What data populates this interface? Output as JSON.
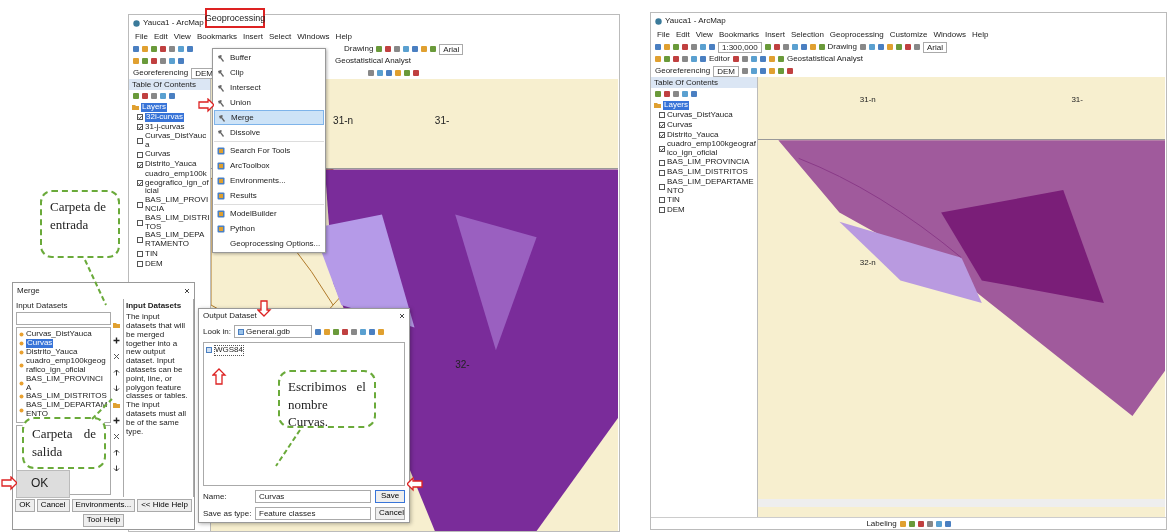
{
  "left_figure": {
    "arcmap": {
      "title": "Yauca1 - ArcMap",
      "menu": [
        "File",
        "Edit",
        "View",
        "Bookmarks",
        "Insert",
        "Select",
        "Windows",
        "Help"
      ],
      "toolbars": [
        {
          "items": [
            {
              "kind": "icons"
            },
            {
              "kind": "label",
              "text": "Drawing"
            },
            {
              "kind": "icons"
            },
            {
              "kind": "combo",
              "value": "Arial"
            }
          ]
        },
        {
          "items": [
            {
              "kind": "icons"
            },
            {
              "kind": "label",
              "text": "Geostatistical Analyst"
            }
          ]
        },
        {
          "items": [
            {
              "kind": "label",
              "text": "Georeferencing"
            },
            {
              "kind": "combo",
              "value": "DEM"
            },
            {
              "kind": "icons"
            }
          ]
        }
      ],
      "toc": {
        "title": "Table Of Contents",
        "root": "Layers",
        "layers": [
          {
            "name": "32i-curvas",
            "checked": true,
            "selected": true
          },
          {
            "name": "31-j-curvas",
            "checked": true,
            "selected": false
          },
          {
            "name": "Curvas_DistYauca",
            "checked": false,
            "selected": false
          },
          {
            "name": "Curvas",
            "checked": false,
            "selected": false
          },
          {
            "name": "Distrito_Yauca",
            "checked": true,
            "selected": false
          },
          {
            "name": "cuadro_emp100kgeografico_ign_oficial",
            "checked": true,
            "selected": false
          },
          {
            "name": "BAS_LIM_PROVINCIA",
            "checked": false,
            "selected": false
          },
          {
            "name": "BAS_LIM_DISTRITOS",
            "checked": false,
            "selected": false
          },
          {
            "name": "BAS_LIM_DEPARTAMENTO",
            "checked": false,
            "selected": false
          },
          {
            "name": "TIN",
            "checked": false,
            "selected": false
          },
          {
            "name": "DEM",
            "checked": false,
            "selected": false
          }
        ]
      },
      "map_labels": [
        "31-n",
        "31-",
        "32-"
      ]
    },
    "geoprocessing_label": "Geoprocessing",
    "geoprocessing_menu": {
      "groups": [
        {
          "items": [
            {
              "label": "Buffer",
              "kind": "tool",
              "selected": false
            },
            {
              "label": "Clip",
              "kind": "tool",
              "selected": false
            },
            {
              "label": "Intersect",
              "kind": "tool",
              "selected": false
            },
            {
              "label": "Union",
              "kind": "tool",
              "selected": false
            },
            {
              "label": "Merge",
              "kind": "tool",
              "selected": true
            },
            {
              "label": "Dissolve",
              "kind": "tool",
              "selected": false
            }
          ]
        },
        {
          "items": [
            {
              "label": "Search For Tools",
              "kind": "app",
              "selected": false
            },
            {
              "label": "ArcToolbox",
              "kind": "app",
              "selected": false
            },
            {
              "label": "Environments...",
              "kind": "app",
              "selected": false
            },
            {
              "label": "Results",
              "kind": "app",
              "selected": false
            }
          ]
        },
        {
          "items": [
            {
              "label": "ModelBuilder",
              "kind": "app",
              "selected": false
            },
            {
              "label": "Python",
              "kind": "app",
              "selected": false
            },
            {
              "label": "Geoprocessing Options...",
              "kind": "text",
              "selected": false
            }
          ]
        }
      ]
    },
    "merge_dialog": {
      "title": "Merge",
      "section": "Input Datasets",
      "datasets": [
        {
          "name": "Curvas_DistYauca",
          "selected": false
        },
        {
          "name": "Curvas",
          "selected": true
        },
        {
          "name": "Distrito_Yauca",
          "selected": false
        },
        {
          "name": "cuadro_emp100kgeografico_ign_oficial",
          "selected": false
        },
        {
          "name": "BAS_LIM_PROVINCIA",
          "selected": false
        },
        {
          "name": "BAS_LIM_DISTRITOS",
          "selected": false
        },
        {
          "name": "BAS_LIM_DEPARTAMENTO",
          "selected": false
        }
      ],
      "help_title": "Input Datasets",
      "help_text": "The input datasets that will be merged together into a new output dataset. Input datasets can be point, line, or polygon feature classes or tables. The input datasets must all be of the same type.",
      "buttons": [
        "OK",
        "Cancel",
        "Environments...",
        "<< Hide Help",
        "Tool Help"
      ]
    },
    "output_dialog": {
      "title": "Output Dataset",
      "look_in_label": "Look in:",
      "look_in": "General.gdb",
      "items": [
        "WGS84"
      ],
      "name_label": "Name:",
      "name": "Curvas",
      "type_label": "Save as type:",
      "type": "Feature classes",
      "buttons": [
        "Save",
        "Cancel"
      ]
    },
    "callouts": [
      "Carpeta de entrada",
      "Carpeta de salida",
      "Escribimos el nombre Curvas."
    ],
    "ok_label": "OK"
  },
  "right_figure": {
    "arcmap": {
      "title": "Yauca1 - ArcMap",
      "menu": [
        "File",
        "Edit",
        "View",
        "Bookmarks",
        "Insert",
        "Selection",
        "Geoprocessing",
        "Customize",
        "Windows",
        "Help"
      ],
      "toolbars": [
        {
          "items": [
            {
              "kind": "icons"
            },
            {
              "kind": "combo",
              "value": "1:300,000"
            },
            {
              "kind": "icons"
            },
            {
              "kind": "label",
              "text": "Drawing"
            },
            {
              "kind": "icons"
            },
            {
              "kind": "combo",
              "value": "Arial"
            }
          ]
        },
        {
          "items": [
            {
              "kind": "icons"
            },
            {
              "kind": "label",
              "text": "Editor"
            },
            {
              "kind": "icons"
            },
            {
              "kind": "label",
              "text": "Geostatistical Analyst"
            }
          ]
        },
        {
          "items": [
            {
              "kind": "label",
              "text": "Georeferencing"
            },
            {
              "kind": "combo",
              "value": "DEM"
            },
            {
              "kind": "icons"
            }
          ]
        }
      ],
      "toc": {
        "title": "Table Of Contents",
        "root": "Layers",
        "layers": [
          {
            "name": "Curvas_DistYauca",
            "checked": false,
            "selected": false
          },
          {
            "name": "Curvas",
            "checked": true,
            "selected": false
          },
          {
            "name": "Distrito_Yauca",
            "checked": true,
            "selected": false
          },
          {
            "name": "cuadro_emp100kgeografico_ign_oficial",
            "checked": true,
            "selected": false
          },
          {
            "name": "BAS_LIM_PROVINCIA",
            "checked": false,
            "selected": false
          },
          {
            "name": "BAS_LIM_DISTRITOS",
            "checked": false,
            "selected": false
          },
          {
            "name": "BAS_LIM_DEPARTAMENTO",
            "checked": false,
            "selected": false
          },
          {
            "name": "TIN",
            "checked": false,
            "selected": false
          },
          {
            "name": "DEM",
            "checked": false,
            "selected": false
          }
        ]
      },
      "map_labels": [
        "31-n",
        "31-",
        "32-n"
      ],
      "status_label": "Labeling"
    }
  }
}
